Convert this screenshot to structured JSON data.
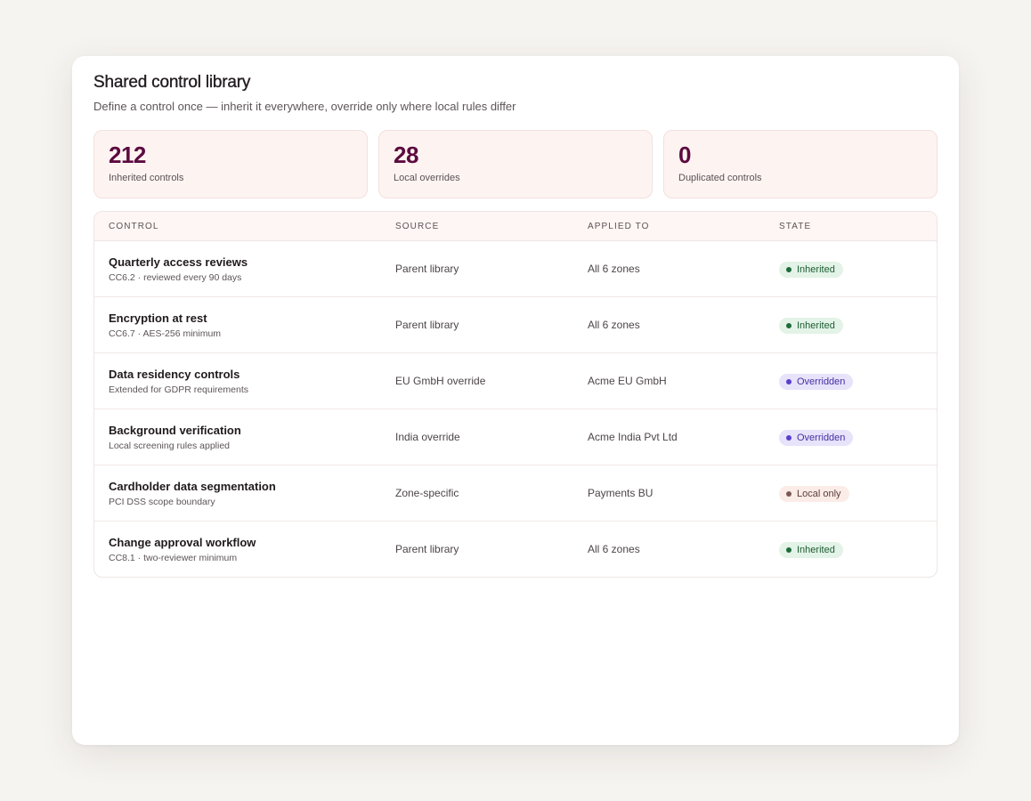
{
  "header": {
    "title": "Shared control library",
    "subtitle": "Define a control once — inherit it everywhere, override only where local rules differ"
  },
  "stats": [
    {
      "value": "212",
      "label": "Inherited controls"
    },
    {
      "value": "28",
      "label": "Local overrides"
    },
    {
      "value": "0",
      "label": "Duplicated controls"
    }
  ],
  "table": {
    "columns": [
      "CONTROL",
      "SOURCE",
      "APPLIED TO",
      "STATE"
    ],
    "rows": [
      {
        "name": "Quarterly access reviews",
        "desc": "CC6.2 · reviewed every 90 days",
        "source": "Parent library",
        "applied": "All 6 zones",
        "state": "Inherited"
      },
      {
        "name": "Encryption at rest",
        "desc": "CC6.7 · AES-256 minimum",
        "source": "Parent library",
        "applied": "All 6 zones",
        "state": "Inherited"
      },
      {
        "name": "Data residency controls",
        "desc": "Extended for GDPR requirements",
        "source": "EU GmbH override",
        "applied": "Acme EU GmbH",
        "state": "Overridden"
      },
      {
        "name": "Background verification",
        "desc": "Local screening rules applied",
        "source": "India override",
        "applied": "Acme India Pvt Ltd",
        "state": "Overridden"
      },
      {
        "name": "Cardholder data segmentation",
        "desc": "PCI DSS scope boundary",
        "source": "Zone-specific",
        "applied": "Payments BU",
        "state": "Local only"
      },
      {
        "name": "Change approval workflow",
        "desc": "CC8.1 · two-reviewer minimum",
        "source": "Parent library",
        "applied": "All 6 zones",
        "state": "Inherited"
      }
    ]
  },
  "colors": {
    "accent": "#5d0b3f",
    "inherited": "#1e6b3a",
    "overridden": "#5a3fd1",
    "local_only": "#7a5a56"
  }
}
